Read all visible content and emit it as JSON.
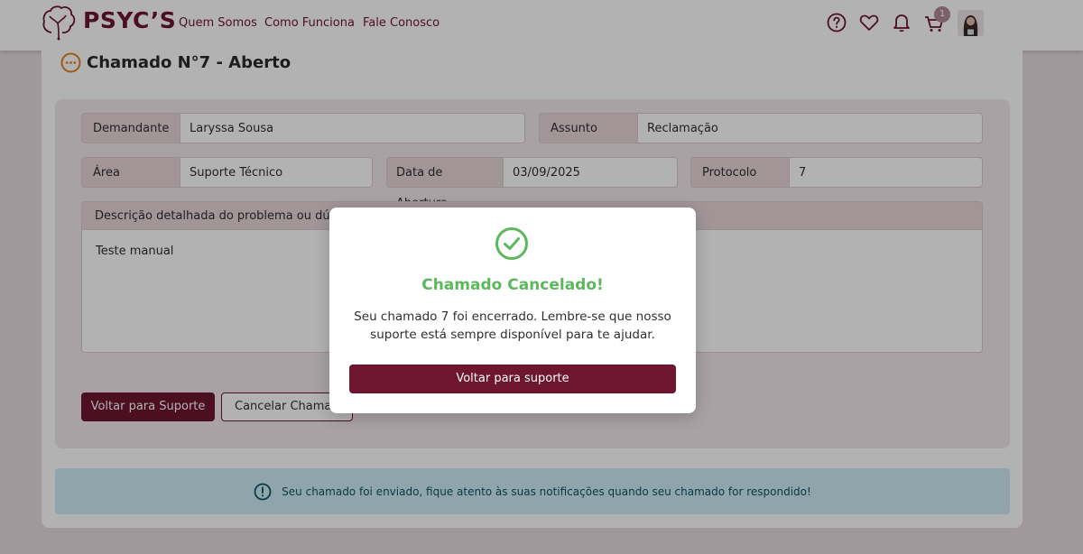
{
  "header": {
    "brand": "PSYC’S",
    "nav": [
      "Quem Somos",
      "Como Funciona",
      "Fale Conosco"
    ],
    "cart_count": "1",
    "icons": [
      "help-icon",
      "heart-icon",
      "bell-icon",
      "cart-icon"
    ]
  },
  "page": {
    "title": "Chamado N°7 - Aberto",
    "fields": {
      "demandante": {
        "label": "Demandante",
        "value": "Laryssa Sousa"
      },
      "assunto": {
        "label": "Assunto",
        "value": "Reclamação"
      },
      "area": {
        "label": "Área",
        "value": "Suporte Técnico"
      },
      "data_abertura": {
        "label": "Data de Abertura",
        "value": "03/09/2025"
      },
      "protocolo": {
        "label": "Protocolo",
        "value": "7"
      }
    },
    "description": {
      "label": "Descrição detalhada do problema ou dúvida",
      "value": "Teste manual"
    },
    "buttons": {
      "back": "Voltar para Suporte",
      "cancel": "Cancelar Chamado"
    }
  },
  "alert": {
    "text": "Seu chamado foi enviado, fique atento às suas notificações quando seu chamado for respondido!"
  },
  "modal": {
    "title": "Chamado Cancelado!",
    "message": "Seu chamado 7 foi encerrado. Lembre-se que nosso suporte está sempre disponível para te ajudar.",
    "button": "Voltar para suporte"
  },
  "colors": {
    "brand": "#6e1530",
    "success": "#5cb85c",
    "alert_bg": "#cdecf5",
    "alert_text": "#0e5363"
  }
}
